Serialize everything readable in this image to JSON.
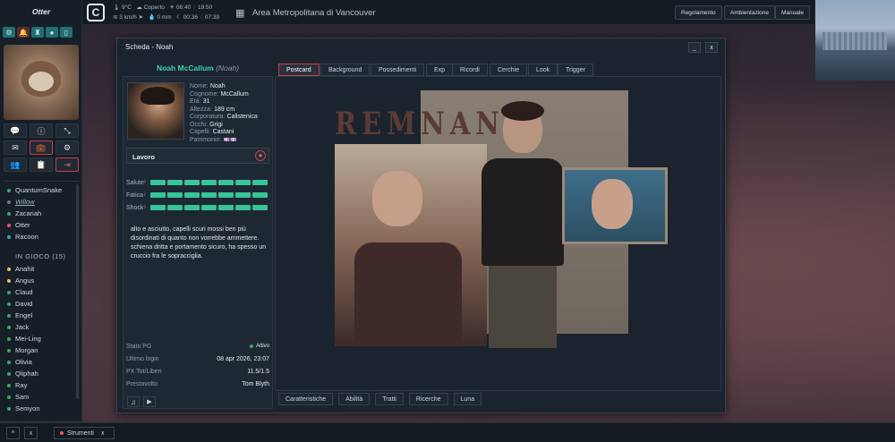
{
  "sidebar": {
    "title": "Otter",
    "online_users": [
      "QuantumSnake",
      "Willow",
      "Zacariah",
      "Otter",
      "Racoon"
    ],
    "in_game_label": "IN GIOCO",
    "in_game_count": "(15)",
    "in_game_users": [
      "Anahit",
      "Angus",
      "Claud",
      "David",
      "Engel",
      "Jack",
      "Mei-Ling",
      "Morgan",
      "Olivia",
      "Qliphah",
      "Ray",
      "Sam",
      "Semyon"
    ]
  },
  "topbar": {
    "temperature": "9°C",
    "weather": "Coperto",
    "sunrise": "06:40",
    "sunset": "19:50",
    "wind": "3 km/h",
    "rain": "0 mm",
    "moonrise": "00:36",
    "moonset": "07:39",
    "location": "Area Metropolitana di Vancouver",
    "buttons": [
      "Regolamento",
      "Ambientazione",
      "Manuale"
    ]
  },
  "window": {
    "title": "Scheda - Noah",
    "minimize": "_",
    "close": "x",
    "character": {
      "name": "Noah McCallum",
      "nick": "(Noah)",
      "fields": [
        {
          "label": "Nome:",
          "value": "Noah"
        },
        {
          "label": "Cognome:",
          "value": "McCallum"
        },
        {
          "label": "Età:",
          "value": "31"
        },
        {
          "label": "Altezza:",
          "value": "189   cm"
        },
        {
          "label": "Corporatura:",
          "value": "Calistenica"
        },
        {
          "label": "Occhi:",
          "value": "Grigi"
        },
        {
          "label": "Capelli:",
          "value": "Castani"
        },
        {
          "label": "Patrimonio:",
          "value": "💷💷"
        }
      ],
      "job_label": "Lavoro",
      "stats": [
        {
          "label": "Salute",
          "marker": "i",
          "level": 1.0
        },
        {
          "label": "Fatica",
          "marker": "i",
          "level": 1.0
        },
        {
          "label": "Shock",
          "marker": "i",
          "level": 1.0
        }
      ],
      "description": "alto e asciutto, capelli scuri mossi ben più disordinati di quanto non vorrebbe ammettere. schiena dritta e portamento sicuro, ha spesso un cruccio fra le sopracciglia.",
      "info": [
        {
          "label": "Stato PG",
          "value": "Attivo"
        },
        {
          "label": "Ultimo login",
          "value": "08 apr 2026, 23:07"
        },
        {
          "label": "PX Tot/Liberi",
          "value": "11.5/1.5"
        },
        {
          "label": "Prestavolto",
          "value": "Tom Blyth"
        }
      ]
    },
    "tabs": [
      "Postcard",
      "Background",
      "Possedimenti",
      "Exp",
      "Ricordi",
      "Cerchie",
      "Look",
      "Trigger"
    ],
    "active_tab": "Postcard",
    "postcard_title": "REMNANT",
    "bottom_tabs": [
      "Caratteristiche",
      "Abilità",
      "Tratti",
      "Ricerche",
      "Luna"
    ]
  },
  "taskbar": {
    "up": "^",
    "close": "x",
    "tool_label": "Strumenti",
    "tool_close": "x"
  },
  "colors": {
    "accent": "#c8404a",
    "health": "#36c49a",
    "name": "#3fd0b8",
    "online": "#3aa66a"
  }
}
